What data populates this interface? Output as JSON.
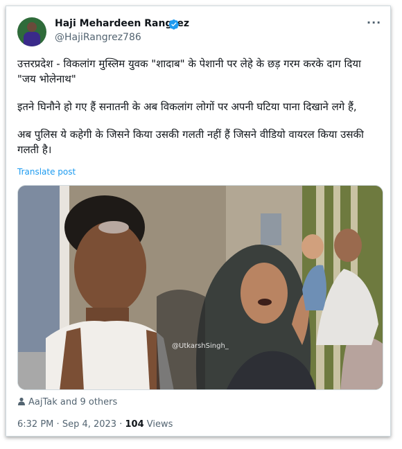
{
  "author": {
    "name": "Haji Mehardeen Rangrez",
    "handle": "@HajiRangrez786"
  },
  "post": {
    "paragraphs": [
      "उत्तरप्रदेश - विकलांग मुस्लिम युवक \"शादाब\" के पेशानी पर लेहे के छड़ गरम करके दाग दिया \"जय भोलेनाथ\"",
      "इतने घिनौने हो गए हैं सनातनी के अब विकलांग लोगों पर अपनी घटिया पाना दिखाने लगे हैं,",
      "अब पुलिस ये कहेगी के जिसने किया उसकी गलती नहीं हैं जिसने वीडियो वायरल किया उसकी गलती है।"
    ],
    "translate_label": "Translate post",
    "media_watermark": "@UtkarshSingh_",
    "liked_by": "AajTak and 9 others",
    "time": "6:32 PM",
    "date": "Sep 4, 2023",
    "views_count": "104",
    "views_label": "Views"
  },
  "icons": {
    "verified": "verified-badge-icon",
    "more": "more-options-icon",
    "person": "person-icon"
  },
  "colors": {
    "accent": "#1d9bf0",
    "text": "#0f1419",
    "muted": "#536471"
  }
}
